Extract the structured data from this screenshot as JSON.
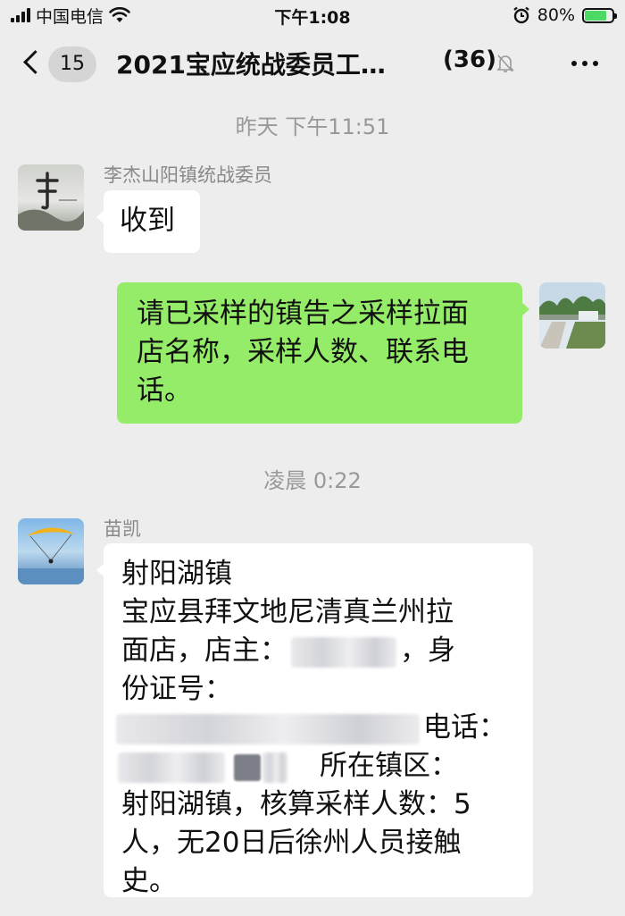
{
  "status_bar": {
    "carrier": "中国电信",
    "time": "下午1:08",
    "battery_percent": "80%",
    "battery_level": 0.8,
    "icons": [
      "signal-icon",
      "wifi-icon",
      "alarm-icon",
      "battery-charging-icon"
    ]
  },
  "nav": {
    "back_icon": "chevron-left-icon",
    "unread_count": "15",
    "title": "2021宝应统战委员工…",
    "member_count": "(36)",
    "mute_icon": "bell-muted-icon",
    "more_icon": "more-icon"
  },
  "chat": {
    "timestamps": [
      "昨天 下午11:51",
      "凌晨 0:22"
    ],
    "messages": [
      {
        "sender": "李杰山阳镇统战委员",
        "side": "left",
        "lines": [
          "收到"
        ]
      },
      {
        "sender": "",
        "side": "right",
        "lines": [
          "请已采样的镇告之采样拉面",
          "店名称，采样人数、联系电",
          "话。"
        ]
      },
      {
        "sender": "苗凯",
        "side": "left",
        "lines": {
          "l1": "射阳湖镇",
          "l2": "宝应县拜文地尼清真兰州拉",
          "l3a": "面店，店主：",
          "l3b": "，身",
          "l4": "份证号：",
          "l5": "电话：",
          "l6": "所在镇区：",
          "l7": "射阳湖镇，核算采样人数：5",
          "l8": "人，无20日后徐州人员接触",
          "l9": "史。"
        }
      }
    ]
  },
  "colors": {
    "background": "#ededed",
    "bubble_self": "#95ec69",
    "bubble_other": "#ffffff",
    "meta_text": "#999999"
  }
}
